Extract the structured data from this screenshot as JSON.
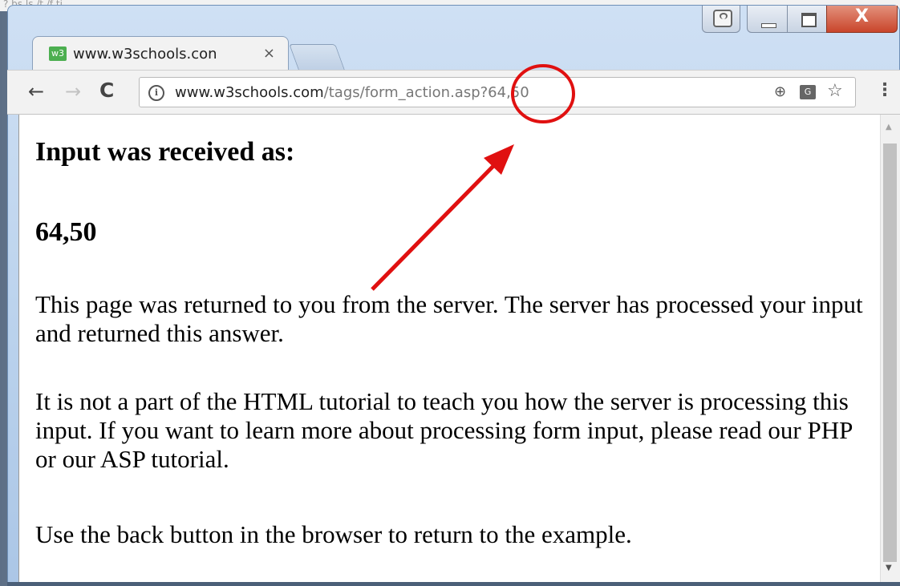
{
  "desktop": {
    "partial_text": "?  bs  ls   /t    /f    ti"
  },
  "window_controls": {
    "user": "person-icon",
    "minimize": "minimize-icon",
    "maximize": "maximize-icon",
    "close_label": "X"
  },
  "tabs": [
    {
      "favicon_label": "w3",
      "title": "www.w3schools.con",
      "close_label": "×"
    }
  ],
  "toolbar": {
    "back_label": "←",
    "forward_label": "→",
    "reload_label": "C",
    "info_label": "i",
    "url_host": "www.w3schools.com",
    "url_path": "/tags/form_action.asp?64,50",
    "zoom_label": "⊕",
    "translate_label": "G",
    "star_label": "☆",
    "menu_label": "⋮"
  },
  "content": {
    "heading": "Input was received as:",
    "value": "64,50",
    "paragraph1": "This page was returned to you from the server. The server has processed your input and returned this answer.",
    "paragraph2": "It is not a part of the HTML tutorial to teach you how the server is processing this input. If you want to learn more about processing form input, please read our PHP or our ASP tutorial.",
    "paragraph3": "Use the back button in the browser to return to the example."
  },
  "scrollbar": {
    "up_label": "▲",
    "down_label": "▼"
  },
  "annotation": {
    "color": "#e01010",
    "shapes": [
      "circle",
      "arrow"
    ]
  }
}
